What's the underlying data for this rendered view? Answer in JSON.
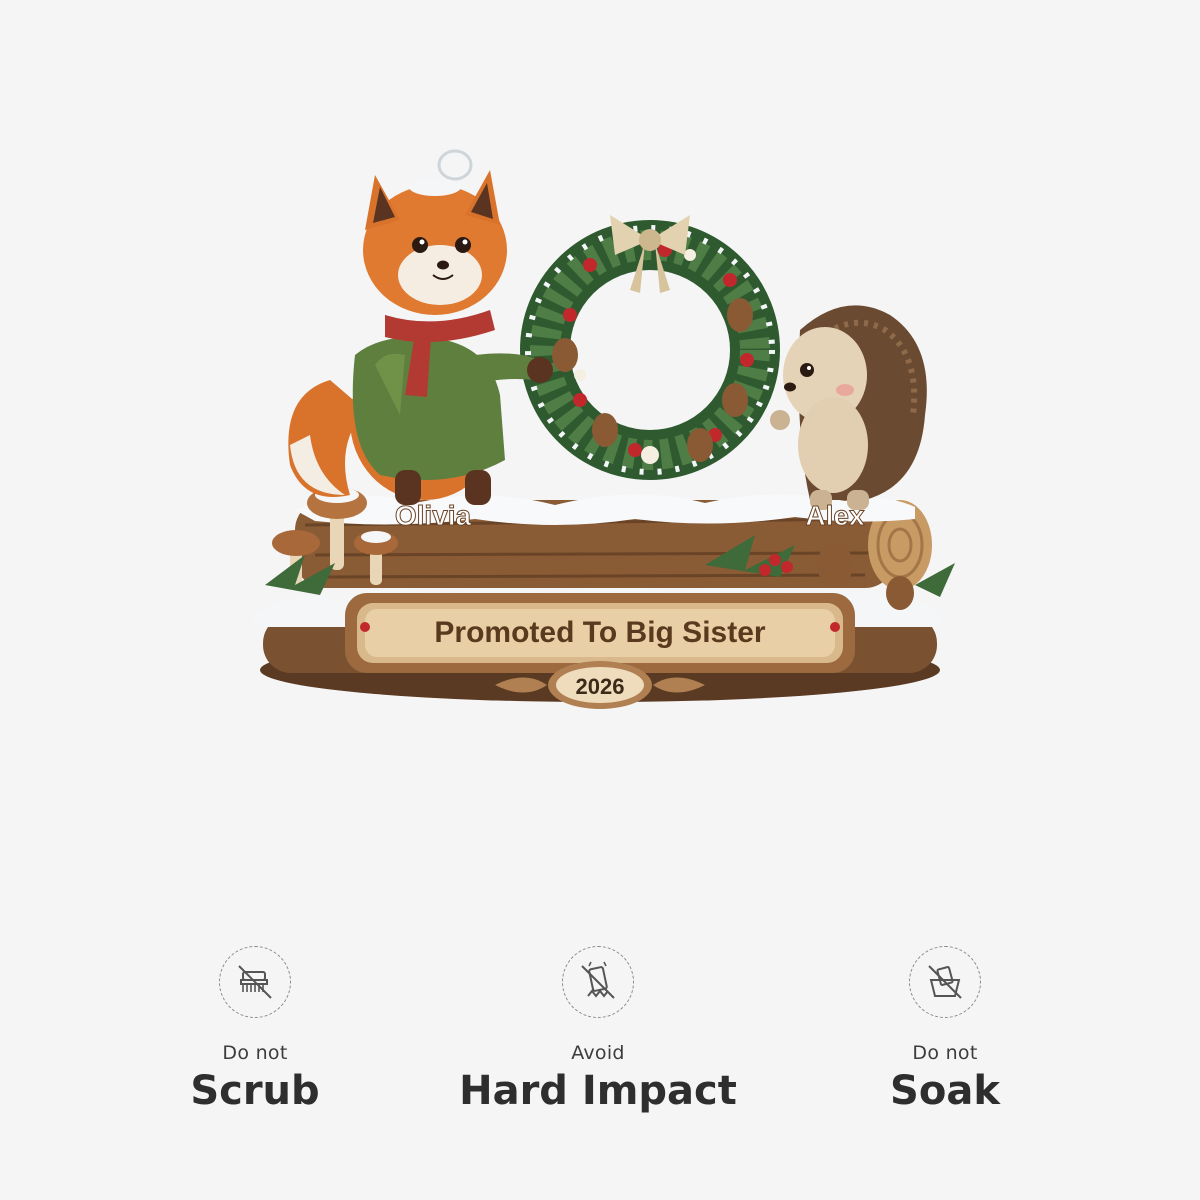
{
  "ornament": {
    "left_name": "Olivia",
    "right_name": "Alex",
    "plaque_title": "Promoted To Big Sister",
    "year": "2026"
  },
  "care": [
    {
      "icon": "no-scrub-icon",
      "small": "Do not",
      "big": "Scrub"
    },
    {
      "icon": "no-impact-icon",
      "small": "Avoid",
      "big": "Hard Impact"
    },
    {
      "icon": "no-soak-icon",
      "small": "Do not",
      "big": "Soak"
    }
  ],
  "colors": {
    "background": "#f5f5f5",
    "plaque_text": "#5a3a1e",
    "wood": "#7a5232",
    "label_text": "#2e2e2e"
  }
}
